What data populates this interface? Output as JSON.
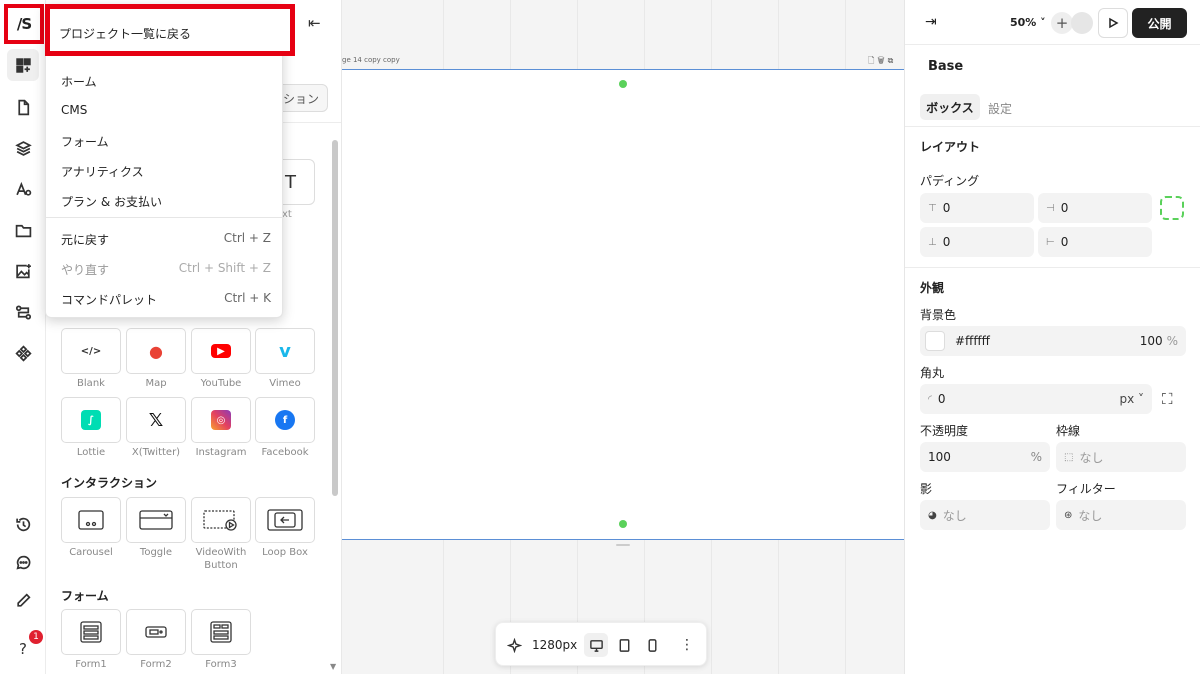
{
  "rail": {
    "logo": "/S",
    "icons": [
      "components-icon",
      "page-icon",
      "layers-icon",
      "typography-icon",
      "folder-icon",
      "image-add-icon",
      "flow-icon",
      "symbols-icon"
    ],
    "bottom_icons": [
      "history-icon",
      "chat-icon",
      "pen-icon",
      "help-icon"
    ],
    "help_label": "?",
    "notification_count": "1"
  },
  "menu": {
    "back_to_projects": "プロジェクト一覧に戻る",
    "items": [
      "ホーム",
      "CMS",
      "フォーム",
      "アナリティクス",
      "プラン & お支払い"
    ],
    "undo": {
      "label": "元に戻す",
      "shortcut": "Ctrl + Z"
    },
    "redo": {
      "label": "やり直す",
      "shortcut": "Ctrl + Shift + Z"
    },
    "palette": {
      "label": "コマンドパレット",
      "shortcut": "Ctrl + K"
    }
  },
  "panel": {
    "tab_partial": "ション",
    "text_tile_glyph": "T",
    "text_tile_partial": "ext",
    "embed_tiles": [
      {
        "label": "Blank",
        "icon": "code-icon",
        "glyph": "</>"
      },
      {
        "label": "Map",
        "icon": "google-maps-icon",
        "glyph": "●"
      },
      {
        "label": "YouTube",
        "icon": "youtube-icon",
        "glyph": "▶"
      },
      {
        "label": "Vimeo",
        "icon": "vimeo-icon",
        "glyph": "v"
      },
      {
        "label": "Lottie",
        "icon": "lottie-icon",
        "glyph": "∫"
      },
      {
        "label": "X(Twitter)",
        "icon": "x-twitter-icon",
        "glyph": "𝕏"
      },
      {
        "label": "Instagram",
        "icon": "instagram-icon",
        "glyph": "◎"
      },
      {
        "label": "Facebook",
        "icon": "facebook-icon",
        "glyph": "f"
      }
    ],
    "interaction_title": "インタラクション",
    "interaction_tiles": [
      {
        "label": "Carousel",
        "icon": "carousel-icon"
      },
      {
        "label": "Toggle",
        "icon": "toggle-icon"
      },
      {
        "label": "VideoWith Button",
        "icon": "video-button-icon"
      },
      {
        "label": "Loop Box",
        "icon": "loop-box-icon"
      }
    ],
    "form_title": "フォーム",
    "form_tiles": [
      {
        "label": "Form1",
        "icon": "form1-icon"
      },
      {
        "label": "Form2",
        "icon": "form2-icon"
      },
      {
        "label": "Form3",
        "icon": "form3-icon"
      }
    ]
  },
  "canvas": {
    "frame_label": "ge 14 copy copy",
    "frame_tools": "🗋🗑⧉",
    "toolbar": {
      "width_label": "1280px"
    }
  },
  "right": {
    "zoom": "50%",
    "publish": "公開",
    "element_name": "Base",
    "tabs": [
      "ボックス",
      "設定"
    ],
    "layout_title": "レイアウト",
    "padding_label": "パディング",
    "padding": {
      "top": "0",
      "right": "0",
      "bottom": "0",
      "left": "0"
    },
    "appearance_title": "外観",
    "bg_label": "背景色",
    "bg_color": "#ffffff",
    "bg_opacity": "100",
    "percent": "%",
    "radius_label": "角丸",
    "radius_value": "0",
    "radius_unit": "px",
    "opacity_label": "不透明度",
    "opacity_value": "100",
    "border_label": "枠線",
    "border_value": "なし",
    "shadow_label": "影",
    "shadow_value": "なし",
    "filter_label": "フィルター",
    "filter_value": "なし"
  },
  "colors": {
    "accent_red": "#e60012",
    "guide_green": "#5ad15a",
    "selection_blue": "#5b8fd6"
  }
}
